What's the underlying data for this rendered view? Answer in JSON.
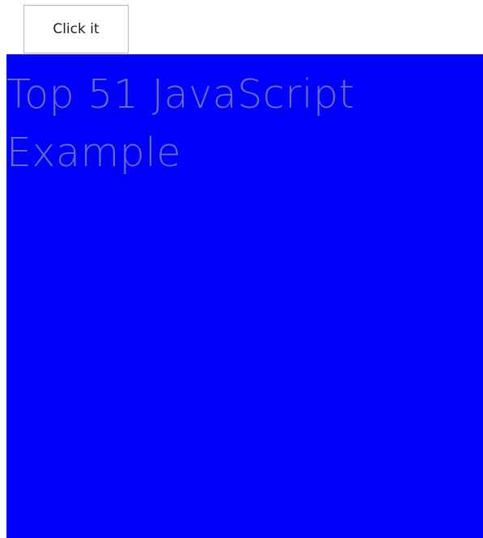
{
  "button": {
    "label": "Click it"
  },
  "panel": {
    "heading": "Top 51 JavaScript Example",
    "background_color": "#0000ff",
    "text_color": "#6b6bbd"
  }
}
